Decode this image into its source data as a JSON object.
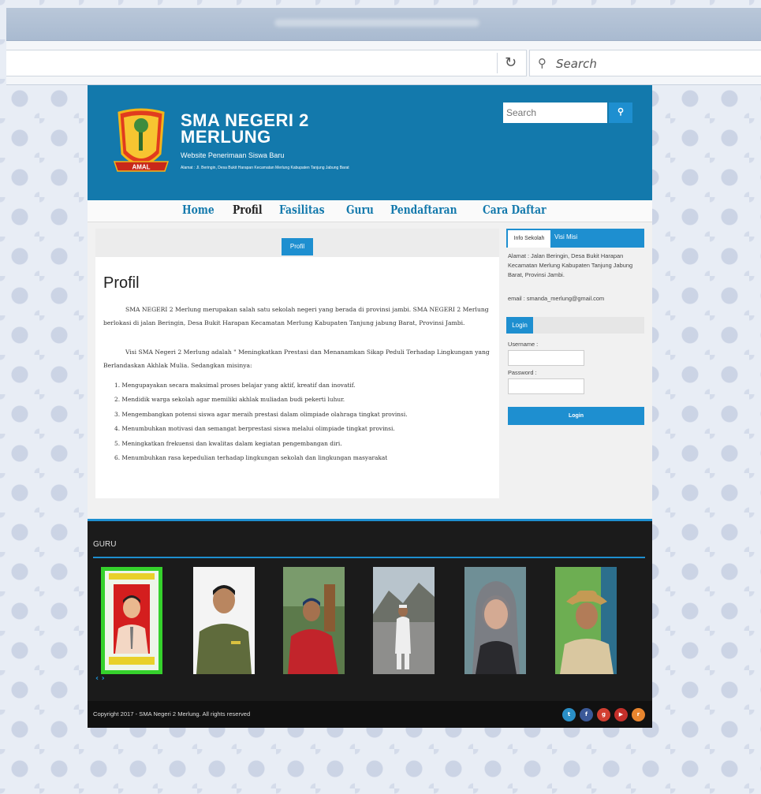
{
  "browser": {
    "search_placeholder": "Search"
  },
  "header": {
    "title": "SMA NEGERI 2 MERLUNG",
    "subtitle": "Website Penerimaan Siswa Baru",
    "address": "Alamat : Jl. Beringin, Desa Bukit Harapan Kecamatan Merlung Kabupaten Tanjung Jabung Barat",
    "logo_text": "AMAL",
    "search_placeholder": "Search"
  },
  "menu": {
    "items": [
      "Home",
      "Profil",
      "Fasilitas",
      "Guru",
      "Pendaftaran",
      "Cara Daftar"
    ]
  },
  "content": {
    "tab_label": "Profil",
    "heading": "Profil",
    "paragraph1": "SMA NEGERI 2 Merlung merupakan salah satu sekolah negeri yang berada di provinsi jambi. SMA NEGERI 2 Merlung berlokasi di jalan Beringin, Desa Bukit Harapan Kecamatan Merlung Kabupaten Tanjung jabung Barat, Provinsi Jambi.",
    "paragraph2": "Visi SMA Negeri 2 Merlung adalah \" Meningkatkan Prestasi dan Menanamkan Sikap Peduli Terhadap Lingkungan yang Berlandaskan Akhlak Mulia. Sedangkan misinya:",
    "missions": [
      "1. Mengupayakan secara maksimal proses belajar yang aktif, kreatif dan inovatif.",
      "2. Mendidik warga sekolah agar memiliki akhlak muliadan budi pekerti luhur.",
      "3. Mengembangkan potensi siswa agar meraih prestasi dalam olimpiade olahraga tingkat provinsi.",
      "4. Menumbuhkan motivasi dan semangat berprestasi siswa melalui olimpiade tingkat provinsi.",
      "5. Meningkatkan frekuensi dan kwalitas dalam kegiatan pengembangan diri.",
      "6. Menumbuhkan rasa kepedulian terhadap lingkungan sekolah dan lingkungan masyarakat"
    ]
  },
  "sidebar": {
    "tab_info": "Info Sekolah",
    "tab_visi": "Visi  Misi",
    "address": "Alamat : Jalan Beringin, Desa Bukit Harapan Kecamatan Merlung Kabupaten Tanjung Jabung Barat, Provinsi Jambi.",
    "email": "email : smanda_merlung@gmail.com",
    "login_title": "Login",
    "username_label": "Username :",
    "password_label": "Password :",
    "login_button": "Login"
  },
  "footer": {
    "guru_title": "GURU",
    "carousel_arrows": "‹ ›",
    "copyright": "Copyright 2017 - SMA Negeri 2 Merlung. All rights reserved",
    "social_icons": [
      "twitter-icon",
      "facebook-icon",
      "google-plus-icon",
      "youtube-icon",
      "rss-icon"
    ],
    "social_glyphs": [
      "t",
      "f",
      "g",
      "▶",
      "r"
    ],
    "social_colors": [
      "#2a8fc7",
      "#3b5998",
      "#d23f31",
      "#c4302b",
      "#e8852e"
    ]
  },
  "colors": {
    "brand_blue": "#1379ac",
    "accent_blue": "#1e8fd0"
  }
}
